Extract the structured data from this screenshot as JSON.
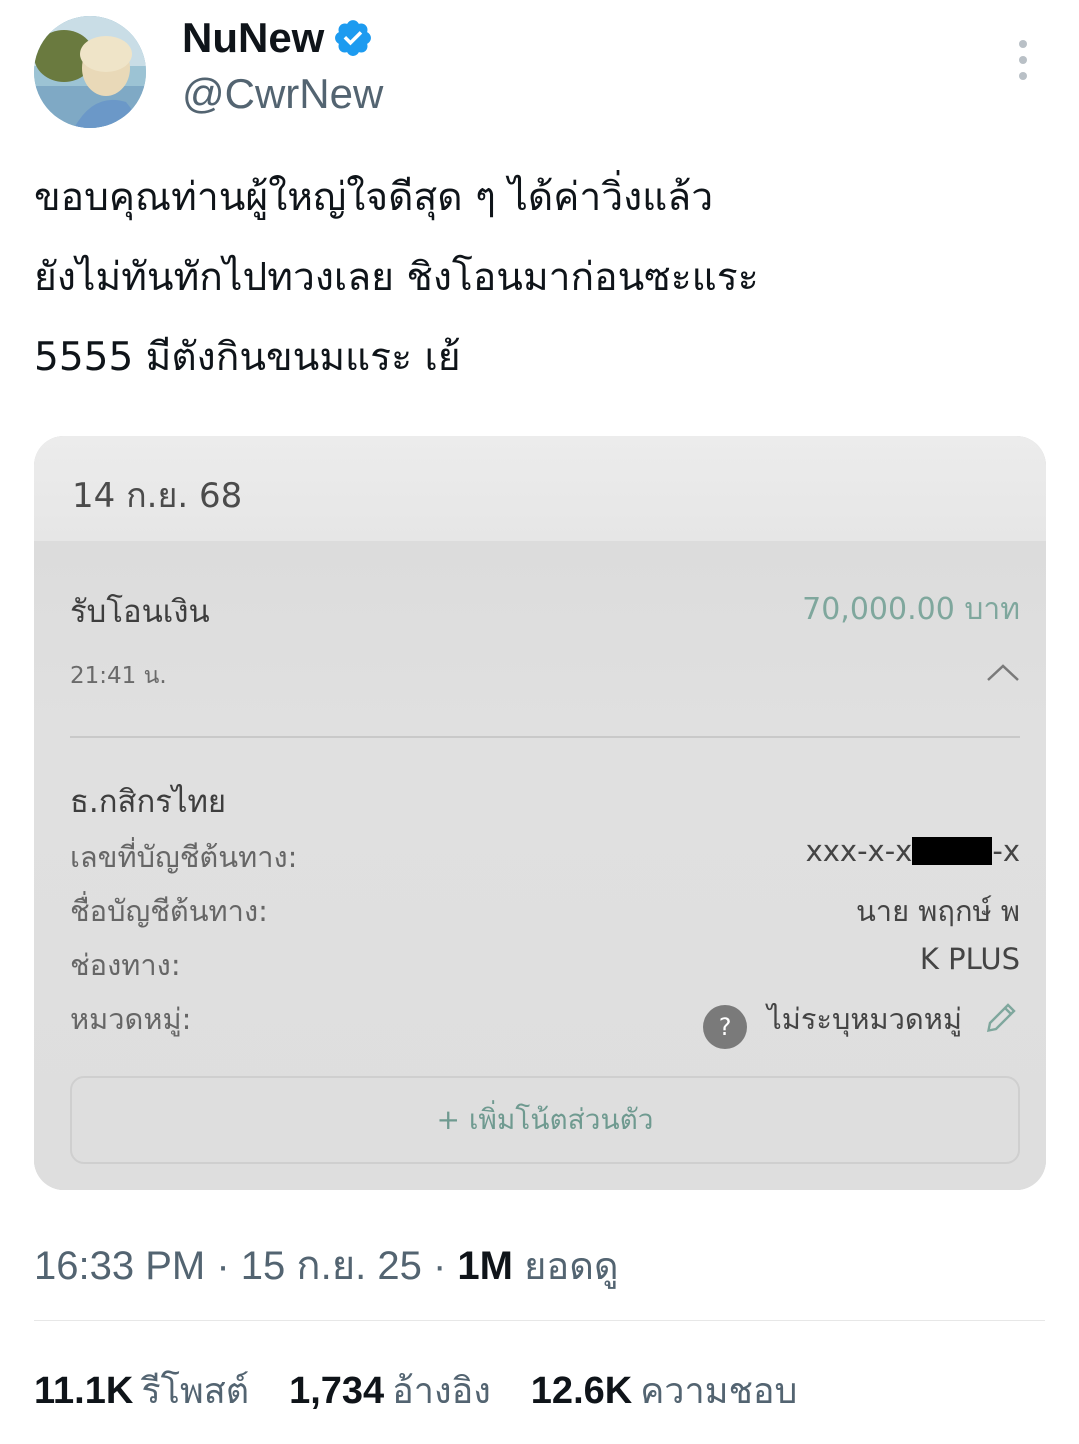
{
  "author": {
    "display_name": "NuNew",
    "handle": "@CwrNew",
    "verified": true
  },
  "tweet": {
    "text": "ขอบคุณท่านผู้ใหญ่ใจดีสุด ๆ  ได้ค่าวิ่งแล้ว\nยังไม่ทันทักไปทวงเลย ชิงโอนมาก่อนซะแระ\n5555 มีตังกินขนมแระ เย้"
  },
  "slip": {
    "date": "14 ก.ย. 68",
    "transaction_label": "รับโอนเงิน",
    "amount": "70,000.00 บาท",
    "time": "21:41 น.",
    "bank": "ธ.กสิกรไทย",
    "rows": [
      {
        "key": "เลขที่บัญชีต้นทาง:",
        "value_prefix": "xxx-x-x",
        "value_suffix": "-x"
      },
      {
        "key": "ชื่อบัญชีต้นทาง:",
        "value": "นาย พฤกษ์ พ"
      },
      {
        "key": "ช่องทาง:",
        "value": "K PLUS"
      },
      {
        "key": "หมวดหมู่:",
        "value": "ไม่ระบุหมวดหมู่"
      }
    ],
    "add_note": "+ เพิ่มโน้ตส่วนตัว"
  },
  "meta": {
    "time": "16:33 PM",
    "date": "15 ก.ย. 25",
    "views_count": "1M",
    "views_label": "ยอดดู"
  },
  "stats": {
    "reposts": "11.1K",
    "reposts_label": "รีโพสต์",
    "quotes": "1,734",
    "quotes_label": "อ้างอิง",
    "likes": "12.6K",
    "likes_label": "ความชอบ"
  },
  "colors": {
    "verified": "#1d9bf0",
    "secondary_text": "#536471",
    "amount_green": "#7fa79d"
  },
  "icons": [
    "verified-badge-icon",
    "more-options-icon",
    "chevron-up-icon",
    "question-icon",
    "pencil-icon"
  ]
}
